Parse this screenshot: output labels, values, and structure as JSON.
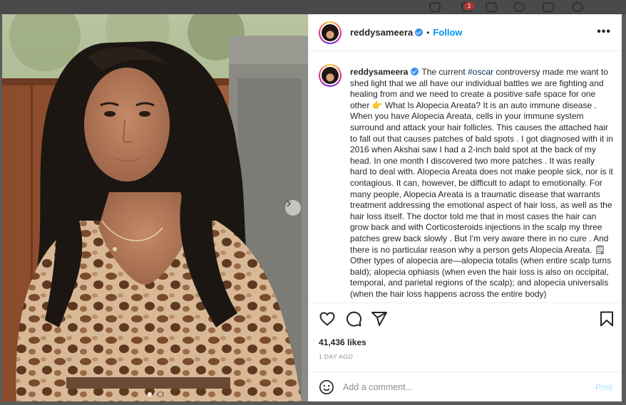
{
  "browser": {
    "notification_count": "1"
  },
  "header": {
    "username": "reddysameera",
    "follow_label": "Follow",
    "separator": "•",
    "more_label": "•••"
  },
  "caption": {
    "username": "reddysameera",
    "text_before_hashtag": "The current ",
    "hashtag": "#oscar",
    "text_after_hashtag": " controversy made me want to shed light that we all have our individual battles we are fighting and healing from and we need to create a positive safe space for one other ",
    "emoji": "👉",
    "body": "What Is Alopecia Areata? It is an auto immune disease . When you have Alopecia Areata, cells in your immune system surround and attack your hair follicles. This causes the attached hair to fall out that causes patches of bald spots . I got diagnosed with it in 2016 when Akshai saw I had a 2-inch bald spot at the back of my head. In one month I discovered two more patches . It was really hard to deal with. Alopecia Areata does not make people sick, nor is it contagious. It can, however, be difficult to adapt to emotionally. For many people, Alopecia Areata is a traumatic disease that warrants treatment addressing the emotional aspect of hair loss, as well as the hair loss itself. The doctor told me that in most cases the hair can grow back and with Corticosteroids injections in the scalp my three patches grew back slowly . But I'm very aware there in no cure . And there is no particular reason why a person gets Alopecia Areata. ",
    "body_emoji": "🗒",
    "body_end": " Other types of alopecia are—alopecia totalis (when entire scalp turns bald); alopecia ophiasis (when even the hair loss is also on occipital, temporal, and parietal regions of the scalp); and alopecia universalis (when the hair loss happens across the entire body)"
  },
  "post": {
    "likes": "41,436 likes",
    "time": "1 DAY AGO"
  },
  "comment": {
    "placeholder": "Add a comment...",
    "post_label": "Post"
  },
  "icons": [
    "heart-icon",
    "comment-icon",
    "share-icon",
    "bookmark-icon",
    "emoji-icon",
    "chevron-right-icon",
    "more-icon",
    "verified-icon"
  ],
  "colors": {
    "follow": "#0095f6",
    "hashtag": "#00376b",
    "post_disabled": "#b2dffc",
    "verified": "#3897f0"
  }
}
